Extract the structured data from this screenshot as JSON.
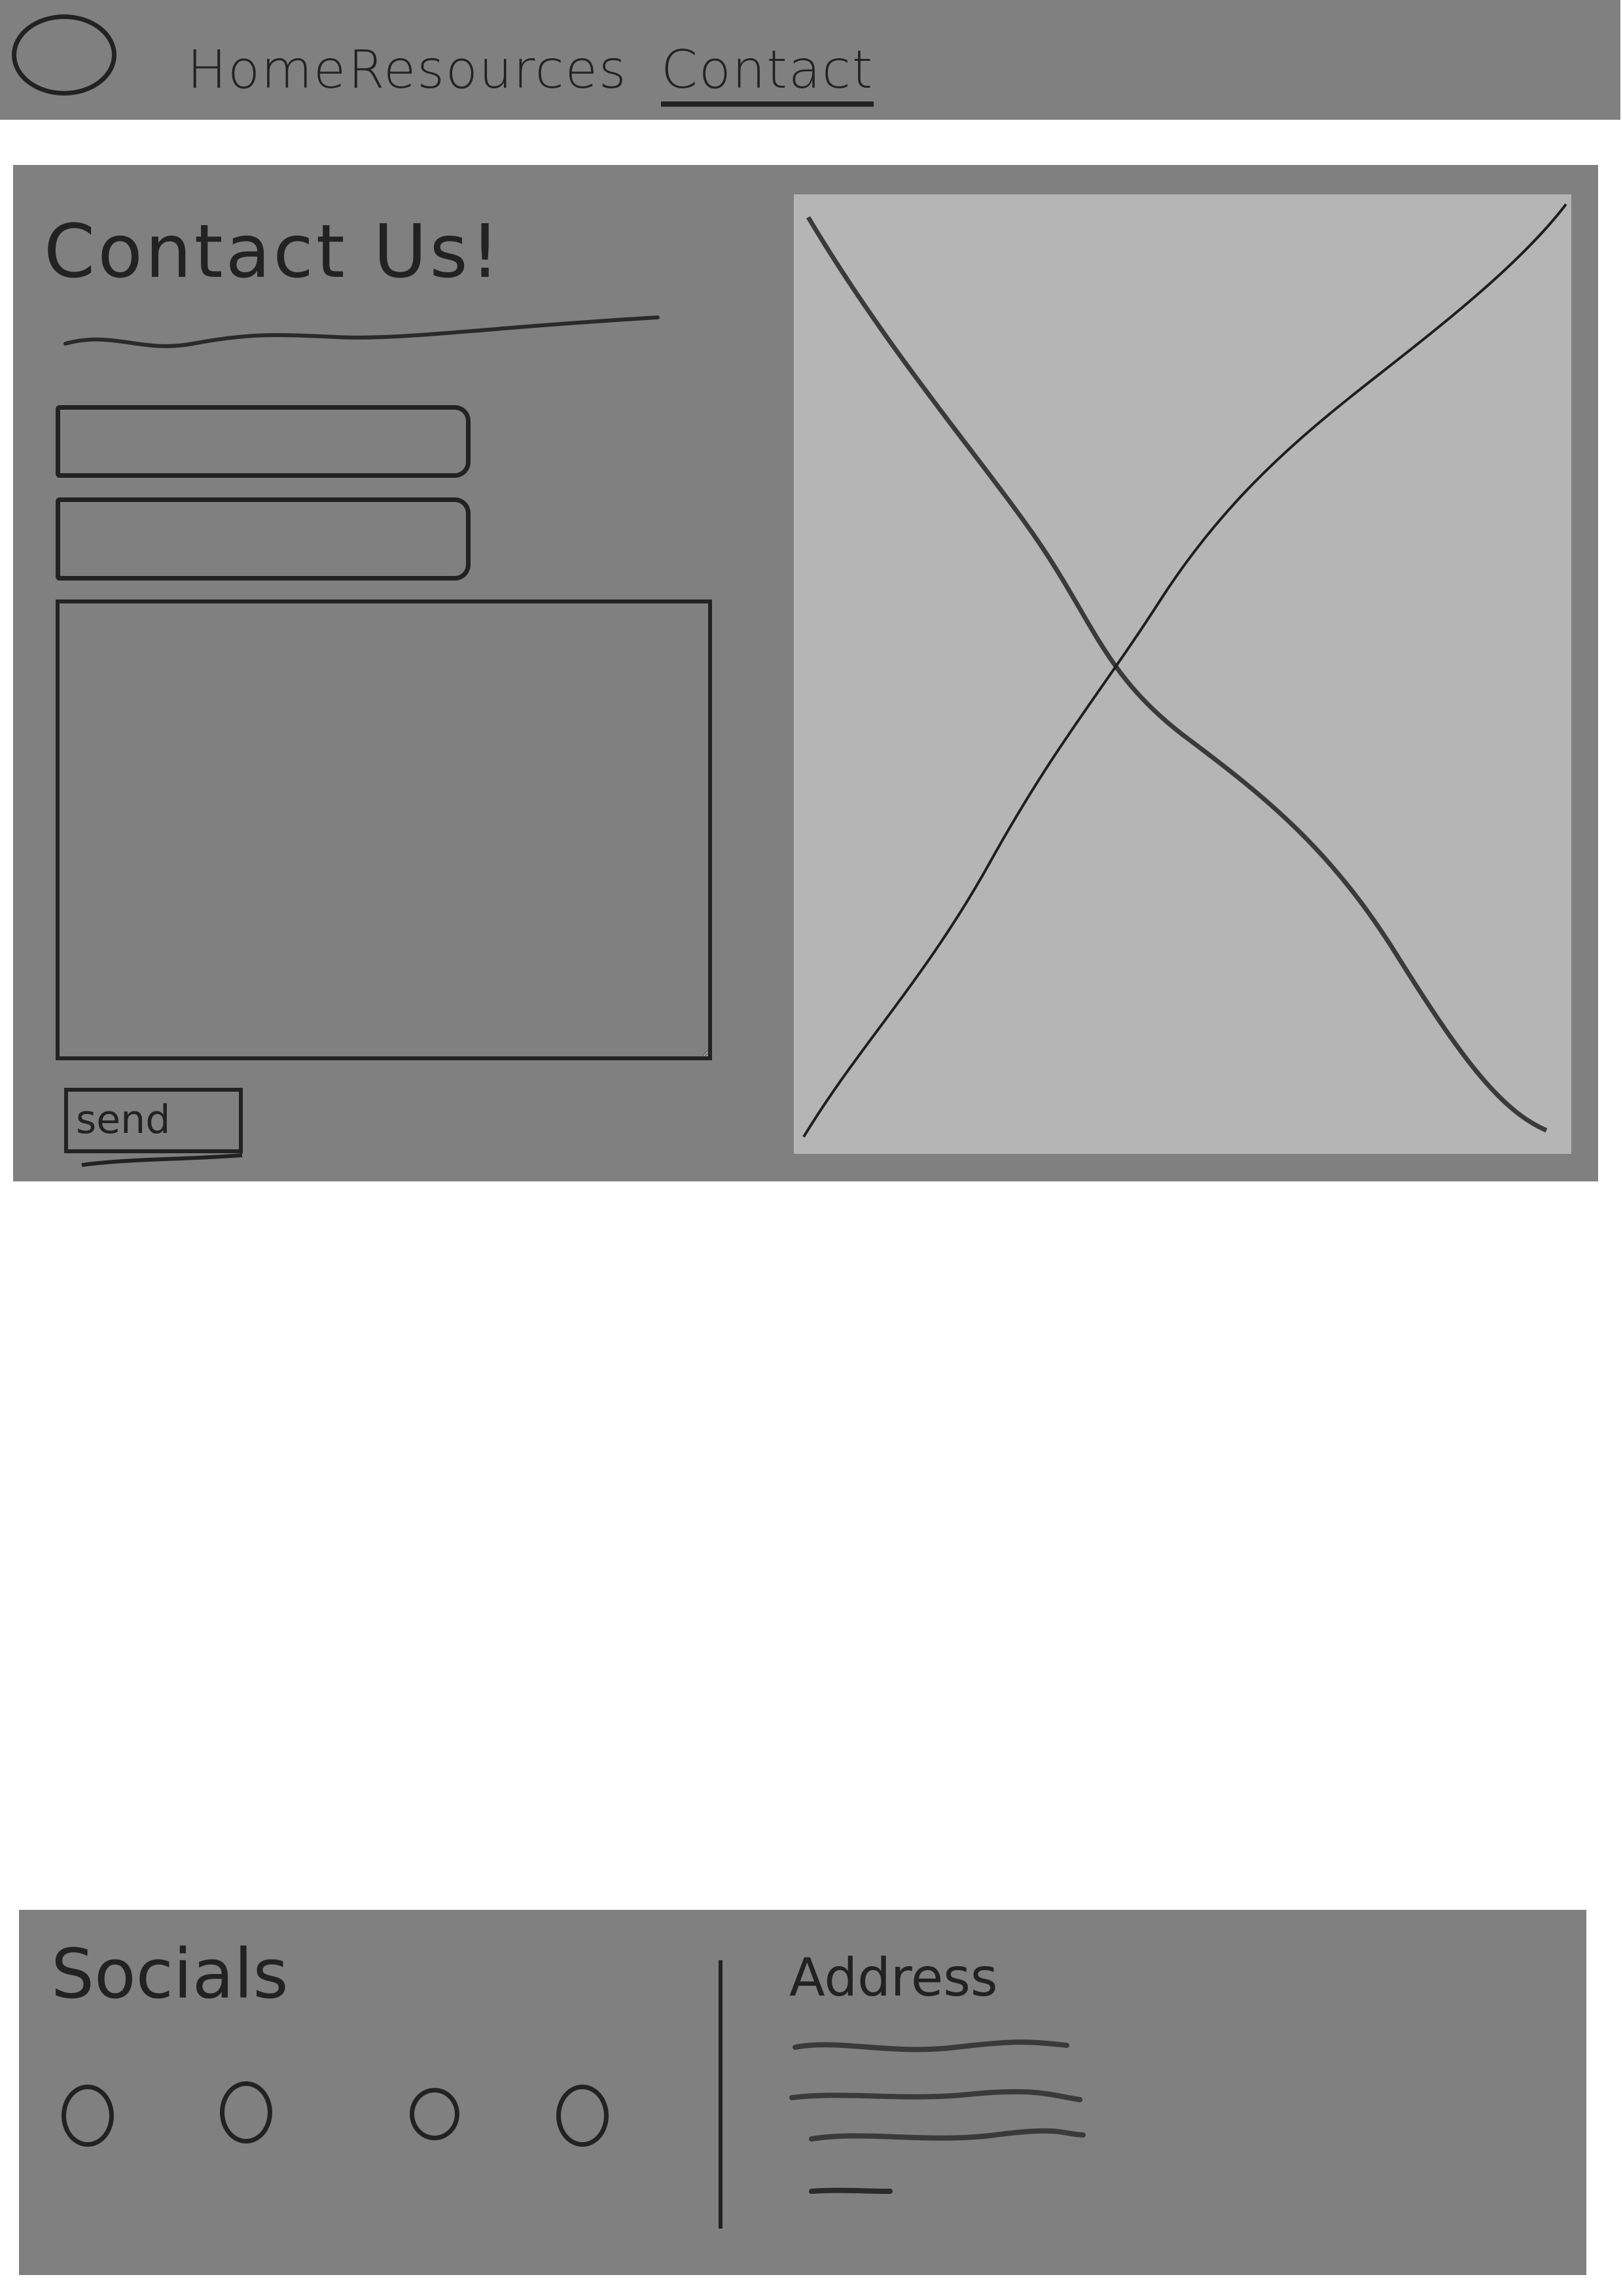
{
  "header": {
    "logo_icon": "circle-logo",
    "nav": [
      {
        "label": "Home",
        "active": false
      },
      {
        "label": "Resources",
        "active": false
      },
      {
        "label": "Contact",
        "active": true
      }
    ]
  },
  "contact": {
    "title": "Contact Us!",
    "fields": [
      {
        "name": "input-1",
        "value": "",
        "placeholder": ""
      },
      {
        "name": "input-2",
        "value": "",
        "placeholder": ""
      }
    ],
    "message": {
      "value": "",
      "placeholder": ""
    },
    "send_label": "send",
    "image_icon": "image-placeholder-x"
  },
  "footer": {
    "socials_title": "Socials",
    "social_icons": [
      "social-icon-1",
      "social-icon-2",
      "social-icon-3",
      "social-icon-4"
    ],
    "address_title": "Address"
  },
  "colors": {
    "panel": "#808080",
    "image_placeholder": "#b5b5b5",
    "ink": "#222222",
    "background": "#ffffff"
  }
}
